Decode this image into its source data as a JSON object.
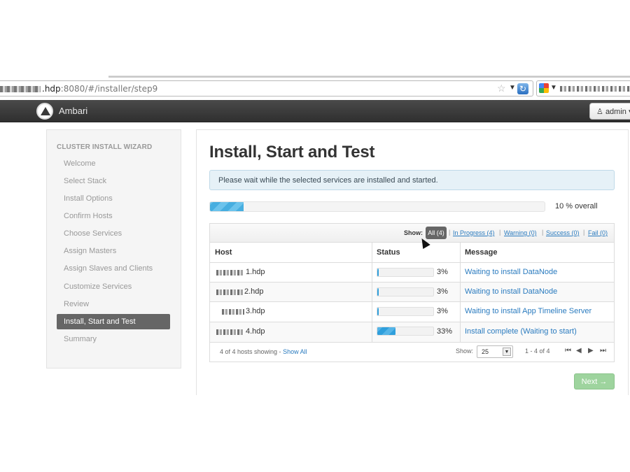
{
  "browser": {
    "url_host_suffix": ".hdp",
    "url_path": ":8080/#/installer/step9"
  },
  "navbar": {
    "brand": "Ambari",
    "user_button": "admin"
  },
  "sidebar": {
    "title": "CLUSTER INSTALL WIZARD",
    "items": [
      {
        "label": "Welcome"
      },
      {
        "label": "Select Stack"
      },
      {
        "label": "Install Options"
      },
      {
        "label": "Confirm Hosts"
      },
      {
        "label": "Choose Services"
      },
      {
        "label": "Assign Masters"
      },
      {
        "label": "Assign Slaves and Clients"
      },
      {
        "label": "Customize Services"
      },
      {
        "label": "Review"
      },
      {
        "label": "Install, Start and Test"
      },
      {
        "label": "Summary"
      }
    ],
    "active_index": 9
  },
  "main": {
    "title": "Install, Start and Test",
    "alert": "Please wait while the selected services are installed and started.",
    "overall_progress": 0.1,
    "overall_label": "10 % overall"
  },
  "filters": {
    "show_label": "Show:",
    "all": "All (4)",
    "in_progress": "In Progress (4)",
    "warning": "Warning (0)",
    "success": "Success (0)",
    "fail": "Fail (0)"
  },
  "table": {
    "headers": {
      "host": "Host",
      "status": "Status",
      "message": "Message"
    },
    "rows": [
      {
        "host_suffix": "1.hdp",
        "progress": 0.03,
        "percent": "3%",
        "message": "Waiting to install DataNode"
      },
      {
        "host_suffix": "2.hdp",
        "progress": 0.03,
        "percent": "3%",
        "message": "Waiting to install DataNode"
      },
      {
        "host_suffix": "3.hdp",
        "progress": 0.03,
        "percent": "3%",
        "message": "Waiting to install App Timeline Server"
      },
      {
        "host_suffix": "4.hdp",
        "progress": 0.33,
        "percent": "33%",
        "message": "Install complete (Waiting to start)"
      }
    ],
    "footer": {
      "showing": "4 of 4 hosts showing - ",
      "show_all": "Show All",
      "show_label": "Show:",
      "page_size": "25",
      "range": "1 - 4 of 4"
    }
  },
  "actions": {
    "next": "Next →"
  },
  "colors": {
    "navbar": "#3a3a3a",
    "link": "#2a7bbf",
    "progress": "#2f9fdc",
    "next_button": "#9ed49e"
  }
}
